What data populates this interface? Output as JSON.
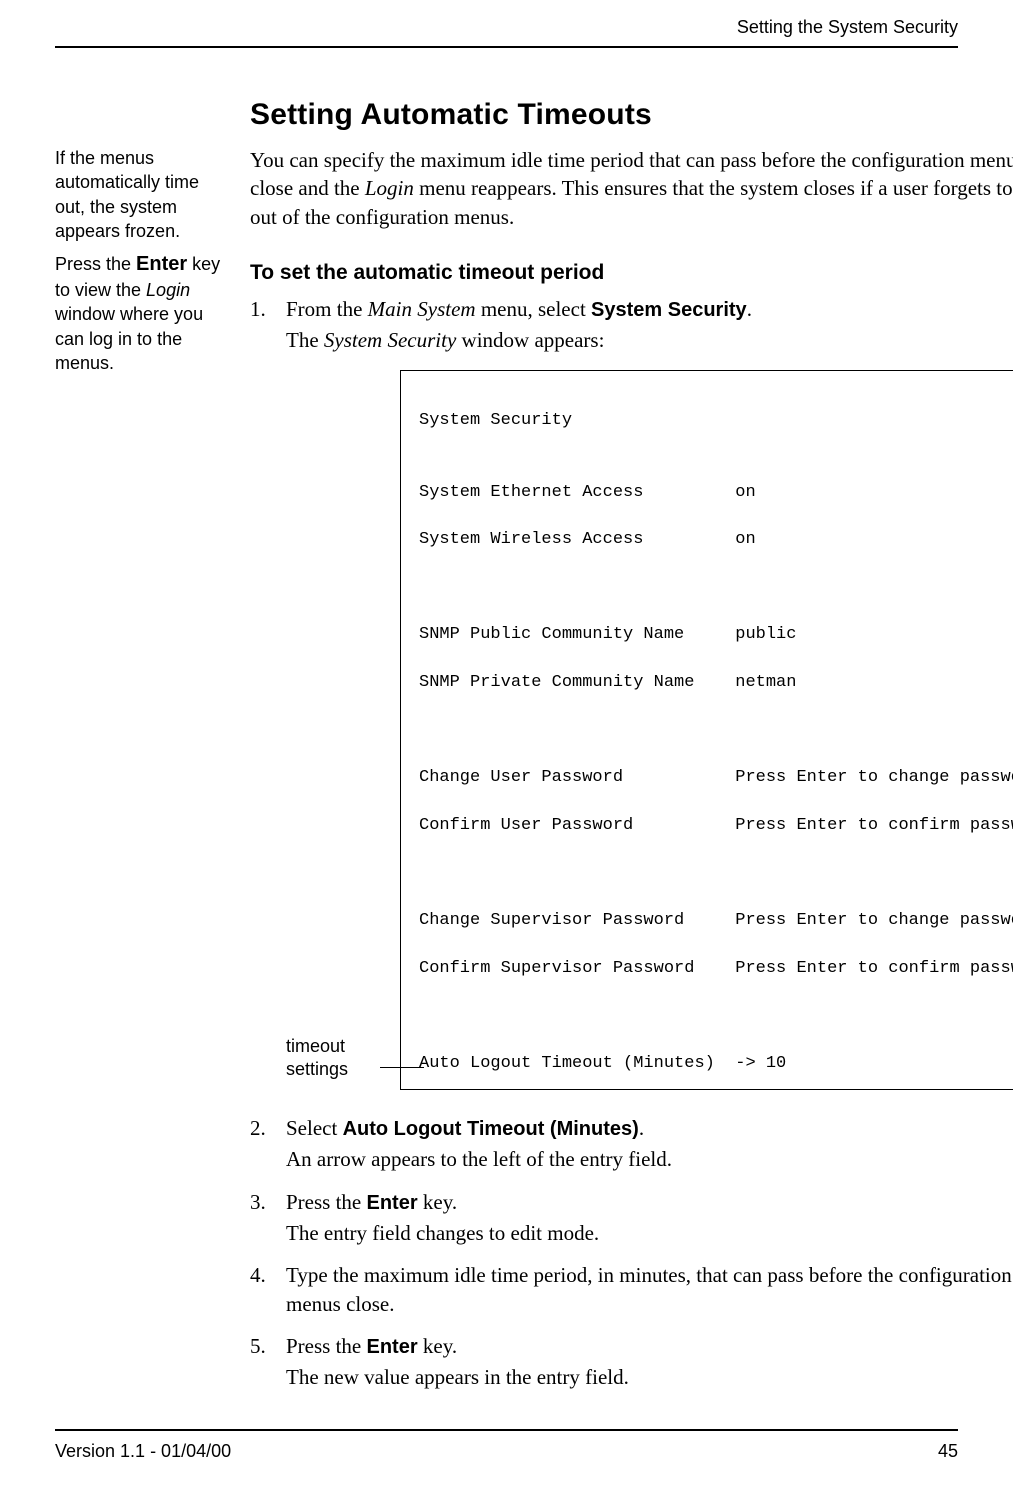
{
  "running_head": "Setting the System Security",
  "footer": {
    "version": "Version 1.1 - 01/04/00",
    "page": "45"
  },
  "h1": "Setting Automatic Timeouts",
  "sidebar": {
    "p1_a": "If the menus automatically time out, the system appears frozen.",
    "p2_a": "Press the ",
    "p2_bold": "Enter",
    "p2_b": " key to view the ",
    "p2_ital": "Login",
    "p2_c": " window where you can log in to the menus."
  },
  "intro": {
    "a": "You can specify the maximum idle time period that can pass before the configuration menus close and the ",
    "login": "Login",
    "b": " menu reappears. This ensures that the system closes if a user forgets to exit out of the configuration menus."
  },
  "h2": "To set the automatic timeout period",
  "steps": {
    "s1": {
      "num": "1.",
      "a": "From the ",
      "ital": "Main System",
      "b": " menu, select ",
      "bold": "System Security",
      "c": ".",
      "sub_a": "The ",
      "sub_ital": "System Security",
      "sub_b": " window appears:"
    },
    "s2": {
      "num": "2.",
      "a": "Select ",
      "bold": "Auto Logout Timeout (Minutes)",
      "b": ".",
      "sub": "An arrow appears to the left of the entry field."
    },
    "s3": {
      "num": "3.",
      "a": "Press the ",
      "bold": "Enter",
      "b": " key.",
      "sub": "The entry field changes to edit mode."
    },
    "s4": {
      "num": "4.",
      "a": "Type the maximum idle time period, in minutes, that can pass before the configuration menus close."
    },
    "s5": {
      "num": "5.",
      "a": "Press the ",
      "bold": "Enter",
      "b": " key.",
      "sub": "The new value appears in the entry field."
    }
  },
  "callout": {
    "l1": "timeout",
    "l2": "settings"
  },
  "terminal": {
    "title": "System Security",
    "r1": "System Ethernet Access         on",
    "r2": "System Wireless Access         on",
    "r3": "SNMP Public Community Name     public",
    "r4": "SNMP Private Community Name    netman",
    "r5": "Change User Password           Press Enter to change password",
    "r6": "Confirm User Password          Press Enter to confirm password",
    "r7": "Change Supervisor Password     Press Enter to change password",
    "r8": "Confirm Supervisor Password    Press Enter to confirm password",
    "r9": "Auto Logout Timeout (Minutes)  -> 10"
  }
}
